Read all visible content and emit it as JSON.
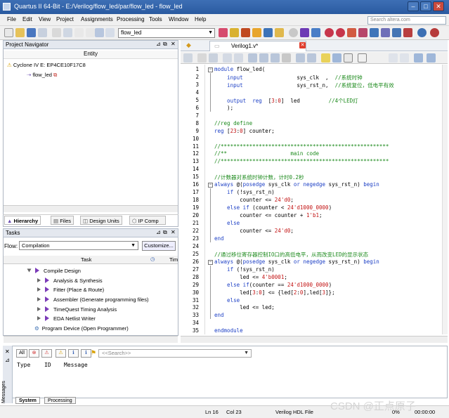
{
  "window": {
    "title": "Quartus II 64-Bit - E:/Verilog/flow_led/par/flow_led - flow_led",
    "minimize": "–",
    "maximize": "□",
    "close": "✕"
  },
  "menu": [
    "File",
    "Edit",
    "View",
    "Project",
    "Assignments",
    "Processing",
    "Tools",
    "Window",
    "Help"
  ],
  "search_placeholder": "Search altera.com",
  "toolbar": {
    "entity_value": "flow_led"
  },
  "project_navigator": {
    "title": "Project Navigator",
    "column": "Entity",
    "device": "Cyclone IV E: EP4CE10F17C8",
    "top_entity": "flow_led",
    "tabs": [
      "Hierarchy",
      "Files",
      "Design Units",
      "IP Comp"
    ]
  },
  "tasks": {
    "title": "Tasks",
    "flow_label": "Flow:",
    "flow_value": "Compilation",
    "customize": "Customize...",
    "column_task": "Task",
    "column_time": "Tim",
    "items": [
      {
        "label": "Compile Design",
        "level": 1
      },
      {
        "label": "Analysis & Synthesis",
        "level": 2
      },
      {
        "label": "Fitter (Place & Route)",
        "level": 2
      },
      {
        "label": "Assembler (Generate programming files)",
        "level": 2
      },
      {
        "label": "TimeQuest Timing Analysis",
        "level": 2
      },
      {
        "label": "EDA Netlist Writer",
        "level": 2
      },
      {
        "label": "Program Device (Open Programmer)",
        "level": 1
      }
    ]
  },
  "editor": {
    "tab": "Verilog1.v*",
    "lines": [
      [
        [
          "kw",
          "module"
        ],
        [
          "tx",
          " flow_led("
        ]
      ],
      [
        [
          "kw",
          "    input"
        ],
        [
          "tx",
          "                 sys_clk  ,  "
        ],
        [
          "cm",
          "//系统时钟"
        ]
      ],
      [
        [
          "kw",
          "    input"
        ],
        [
          "tx",
          "                 sys_rst_n,  "
        ],
        [
          "cm",
          "//系统复位，低电平有效"
        ]
      ],
      [
        [
          "tx",
          ""
        ]
      ],
      [
        [
          "kw",
          "    output"
        ],
        [
          "tx",
          "  "
        ],
        [
          "kw",
          "reg"
        ],
        [
          "tx",
          "  ["
        ],
        [
          "num",
          "3"
        ],
        [
          "tx",
          ":"
        ],
        [
          "num",
          "0"
        ],
        [
          "tx",
          "]  led         "
        ],
        [
          "cm",
          "//4个LED灯"
        ]
      ],
      [
        [
          "tx",
          "    );"
        ]
      ],
      [
        [
          "tx",
          ""
        ]
      ],
      [
        [
          "cm",
          "//reg define"
        ]
      ],
      [
        [
          "kw",
          "reg"
        ],
        [
          "tx",
          " ["
        ],
        [
          "num",
          "23"
        ],
        [
          "tx",
          ":"
        ],
        [
          "num",
          "0"
        ],
        [
          "tx",
          "] counter;"
        ]
      ],
      [
        [
          "tx",
          ""
        ]
      ],
      [
        [
          "cm",
          "//*****************************************************"
        ]
      ],
      [
        [
          "cm",
          "//**                    main code"
        ]
      ],
      [
        [
          "cm",
          "//*****************************************************"
        ]
      ],
      [
        [
          "tx",
          ""
        ]
      ],
      [
        [
          "cm",
          "//计数器对系统时钟计数，计时0.2秒"
        ]
      ],
      [
        [
          "kw",
          "always"
        ],
        [
          "tx",
          " @("
        ],
        [
          "kw",
          "posedge"
        ],
        [
          "tx",
          " sys_clk "
        ],
        [
          "kw",
          "or"
        ],
        [
          "tx",
          " "
        ],
        [
          "kw",
          "negedge"
        ],
        [
          "tx",
          " sys_rst_n) "
        ],
        [
          "kw",
          "begin"
        ]
      ],
      [
        [
          "kw",
          "    if"
        ],
        [
          "tx",
          " (!sys_rst_n)"
        ]
      ],
      [
        [
          "tx",
          "        counter <= "
        ],
        [
          "num",
          "24'd0"
        ],
        [
          "tx",
          ";"
        ]
      ],
      [
        [
          "kw",
          "    else if"
        ],
        [
          "tx",
          " (counter < "
        ],
        [
          "num",
          "24'd1000_0000"
        ],
        [
          "tx",
          ")"
        ]
      ],
      [
        [
          "tx",
          "        counter <= counter + "
        ],
        [
          "num",
          "1'b1"
        ],
        [
          "tx",
          ";"
        ]
      ],
      [
        [
          "kw",
          "    else"
        ]
      ],
      [
        [
          "tx",
          "        counter <= "
        ],
        [
          "num",
          "24'd0"
        ],
        [
          "tx",
          ";"
        ]
      ],
      [
        [
          "kw",
          "end"
        ]
      ],
      [
        [
          "tx",
          ""
        ]
      ],
      [
        [
          "cm",
          "//通过移位寄存器控制IO口的高低电平，从而改变LED的显示状态"
        ]
      ],
      [
        [
          "kw",
          "always"
        ],
        [
          "tx",
          " @("
        ],
        [
          "kw",
          "posedge"
        ],
        [
          "tx",
          " sys_clk "
        ],
        [
          "kw",
          "or"
        ],
        [
          "tx",
          " "
        ],
        [
          "kw",
          "negedge"
        ],
        [
          "tx",
          " sys_rst_n) "
        ],
        [
          "kw",
          "begin"
        ]
      ],
      [
        [
          "kw",
          "    if"
        ],
        [
          "tx",
          " (!sys_rst_n)"
        ]
      ],
      [
        [
          "tx",
          "        led <= "
        ],
        [
          "num",
          "4'b0001"
        ],
        [
          "tx",
          ";"
        ]
      ],
      [
        [
          "kw",
          "    else if"
        ],
        [
          "tx",
          "(counter == "
        ],
        [
          "num",
          "24'd1000_0000"
        ],
        [
          "tx",
          ")"
        ]
      ],
      [
        [
          "tx",
          "        led["
        ],
        [
          "num",
          "3"
        ],
        [
          "tx",
          ":"
        ],
        [
          "num",
          "0"
        ],
        [
          "tx",
          "] <= {led["
        ],
        [
          "num",
          "2"
        ],
        [
          "tx",
          ":"
        ],
        [
          "num",
          "0"
        ],
        [
          "tx",
          "],led["
        ],
        [
          "num",
          "3"
        ],
        [
          "tx",
          "]};"
        ]
      ],
      [
        [
          "kw",
          "    else"
        ]
      ],
      [
        [
          "tx",
          "        led <= led;"
        ]
      ],
      [
        [
          "kw",
          "end"
        ]
      ],
      [
        [
          "tx",
          ""
        ]
      ],
      [
        [
          "kw",
          "endmodule"
        ]
      ]
    ]
  },
  "messages": {
    "search_placeholder": "<<Search>>",
    "all_label": "All",
    "side_label": "Messages",
    "columns": [
      "Type",
      "ID",
      "Message"
    ],
    "tabs": [
      "System",
      "Processing"
    ]
  },
  "status": {
    "ln": "Ln 16",
    "col": "Col 23",
    "file_type": "Verilog HDL File",
    "progress": "0%",
    "time": "00:00:00"
  },
  "watermark": "CSDN @正点原子"
}
